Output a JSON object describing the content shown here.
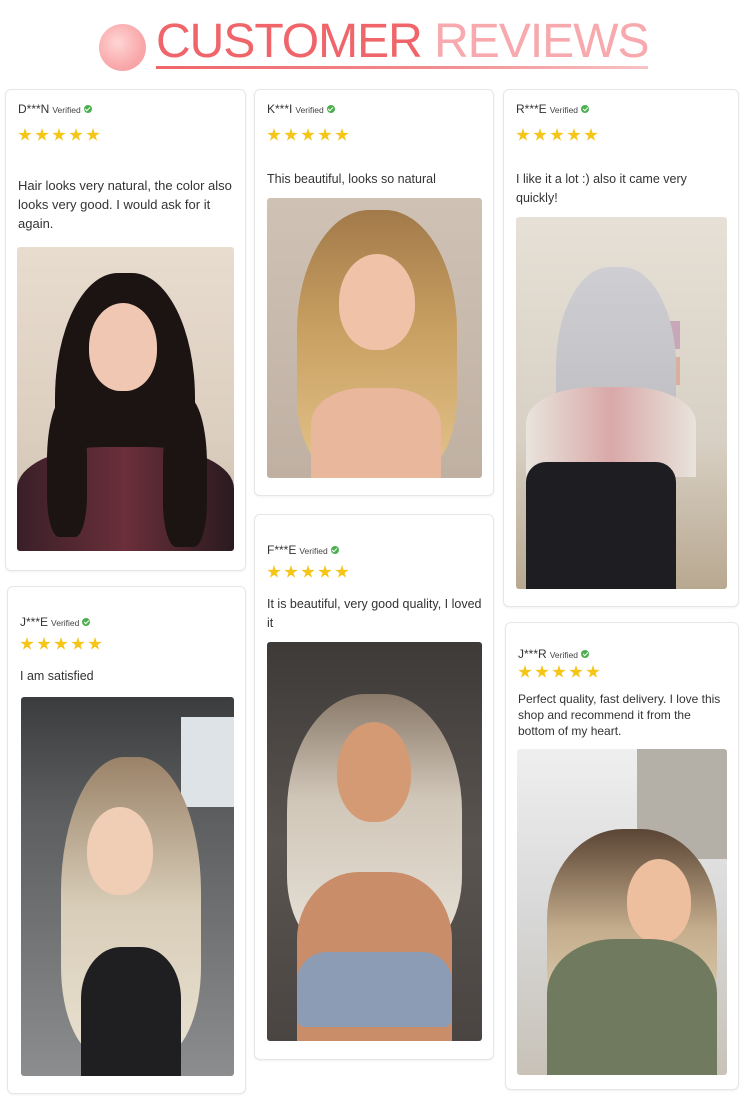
{
  "header": {
    "title_word1": "CUSTOMER",
    "title_word2": "REVIEWS"
  },
  "reviews": [
    {
      "name": "D***N",
      "verified": "Verified",
      "rating": 5,
      "text": "Hair looks very natural, the color also looks very good. I would ask for it again.",
      "photo_icon": "customer-photo"
    },
    {
      "name": "K***I",
      "verified": "Verified",
      "rating": 5,
      "text": "This beautiful, looks so natural",
      "photo_icon": "customer-photo"
    },
    {
      "name": "R***E",
      "verified": "Verified",
      "rating": 5,
      "text": "I like it a lot :) also it came very quickly!",
      "photo_icon": "customer-photo"
    },
    {
      "name": "J***E",
      "verified": "Verified",
      "rating": 5,
      "text": "I am satisfied",
      "photo_icon": "customer-photo"
    },
    {
      "name": "F***E",
      "verified": "Verified",
      "rating": 5,
      "text": "It is beautiful, very good quality, I loved it",
      "photo_icon": "customer-photo"
    },
    {
      "name": "J***R",
      "verified": "Verified",
      "rating": 5,
      "text": "Perfect quality, fast delivery. I love this shop and recommend it from the bottom of my heart.",
      "photo_icon": "customer-photo"
    }
  ],
  "colors": {
    "title_primary": "#f0656a",
    "title_secondary": "#f7a9ad",
    "star": "#f5c518",
    "verified_check": "#4caf50"
  }
}
